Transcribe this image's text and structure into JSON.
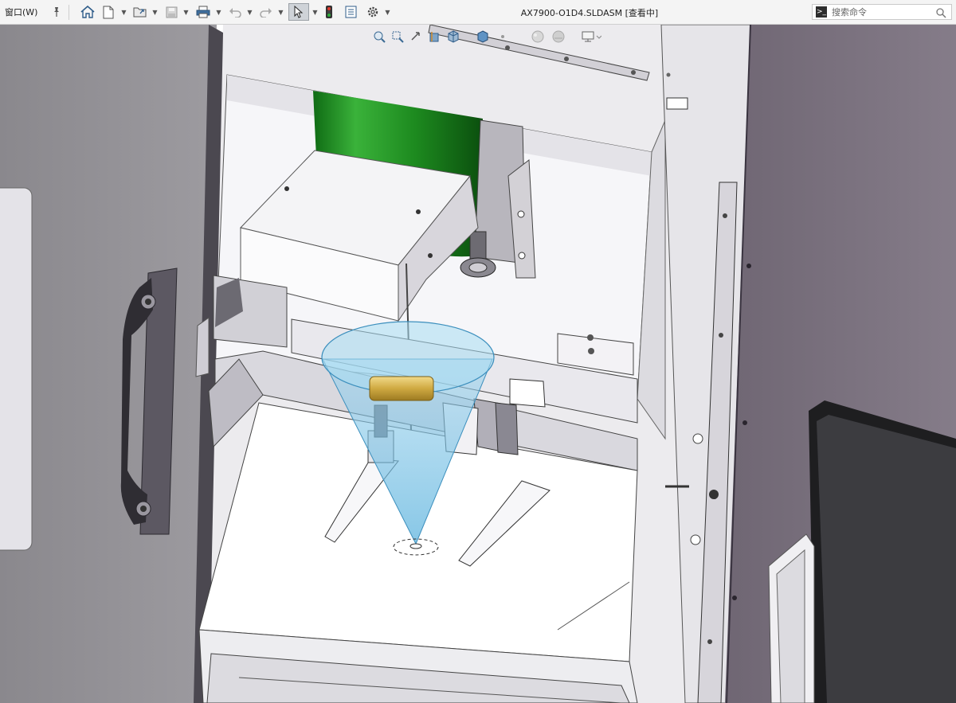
{
  "menu": {
    "window_label": "窗口(W)"
  },
  "toolbar": {
    "title": "AX7900-O1D4.SLDASM [查看中]",
    "icons": [
      "pin-icon",
      "home-icon",
      "new-document-icon",
      "open-folder-icon",
      "save-icon",
      "print-icon",
      "undo-icon",
      "redo-icon",
      "select-cursor-icon",
      "traffic-light-icon",
      "file-properties-icon",
      "options-gear-icon"
    ]
  },
  "search": {
    "placeholder": "搜索命令"
  },
  "heads_up_toolbar": {
    "icons": [
      "zoom-to-fit-icon",
      "zoom-area-icon",
      "previous-view-icon",
      "section-view-icon",
      "view-orientation-icon",
      "display-style-icon",
      "hide-show-items-icon",
      "edit-appearance-icon",
      "apply-scene-icon",
      "view-settings-icon"
    ]
  },
  "colors": {
    "toolbar_bg": "#f4f4f4",
    "viewport_bg": "#ffffff",
    "sheet_metal": "#e8e6ea",
    "door_left": "#8f8d92",
    "door_right": "#7c7480",
    "motor_green": "#1e8a1e",
    "cone_blue": "#8ecae6",
    "brass": "#d9b552"
  }
}
